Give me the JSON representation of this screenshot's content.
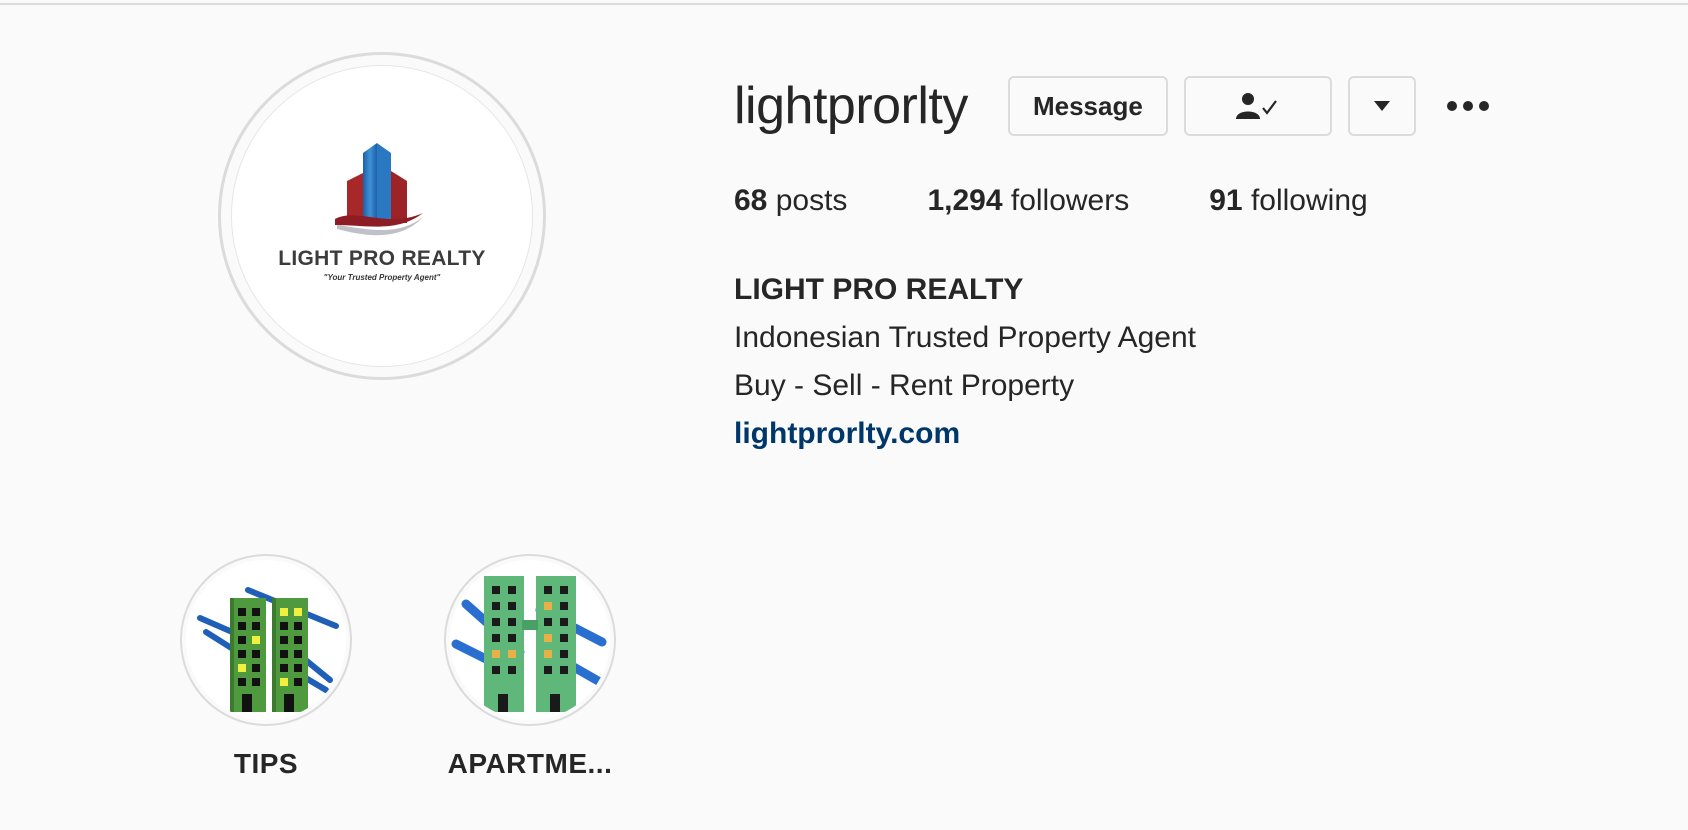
{
  "profile": {
    "username": "lightprorlty",
    "avatar": {
      "logo_text": "LIGHT PRO REALTY",
      "logo_tagline": "\"Your Trusted Property Agent\""
    }
  },
  "actions": {
    "message_label": "Message",
    "following_icon": "person-check-icon",
    "dropdown_icon": "caret-down-icon",
    "more_icon": "more-dots-icon"
  },
  "stats": {
    "posts_count": "68",
    "posts_label": "posts",
    "followers_count": "1,294",
    "followers_label": "followers",
    "following_count": "91",
    "following_label": "following"
  },
  "bio": {
    "name": "LIGHT PRO REALTY",
    "line1": "Indonesian Trusted Property Agent",
    "line2": "Buy - Sell - Rent Property",
    "link": "lightprorlty.com"
  },
  "highlights": [
    {
      "label": "TIPS"
    },
    {
      "label": "APARTME..."
    }
  ],
  "colors": {
    "link": "#00376b",
    "border": "#dbdbdb",
    "background": "#fafafa",
    "text": "#262626"
  }
}
